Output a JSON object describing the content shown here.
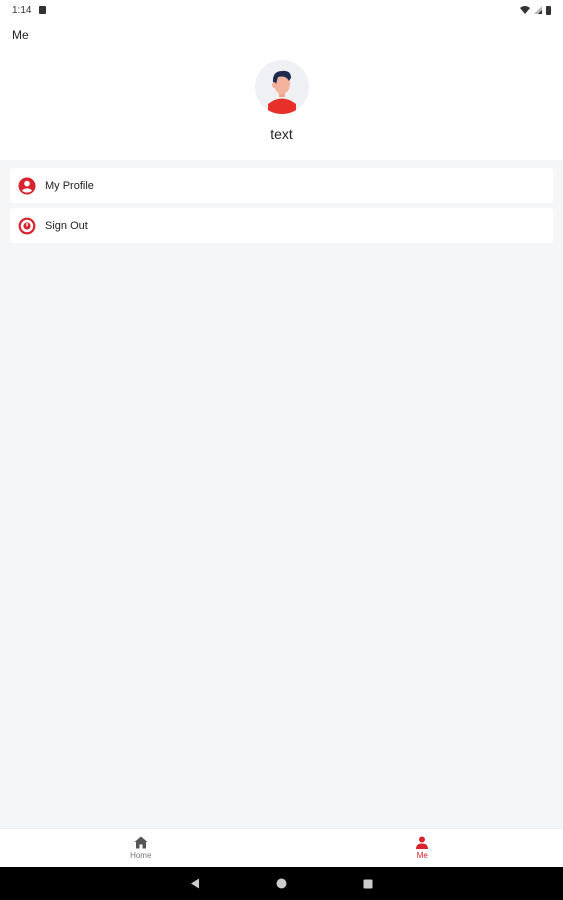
{
  "status_bar": {
    "time": "1:14"
  },
  "header": {
    "title": "Me"
  },
  "profile": {
    "username": "text"
  },
  "menu": {
    "items": [
      {
        "label": "My Profile",
        "icon": "account-circle-icon"
      },
      {
        "label": "Sign Out",
        "icon": "power-icon"
      }
    ]
  },
  "bottom_nav": {
    "tabs": [
      {
        "label": "Home",
        "icon": "home-icon",
        "active": false
      },
      {
        "label": "Me",
        "icon": "person-icon",
        "active": true
      }
    ]
  },
  "colors": {
    "accent": "#d9232d",
    "background": "#f5f6f8",
    "card": "#ffffff"
  }
}
